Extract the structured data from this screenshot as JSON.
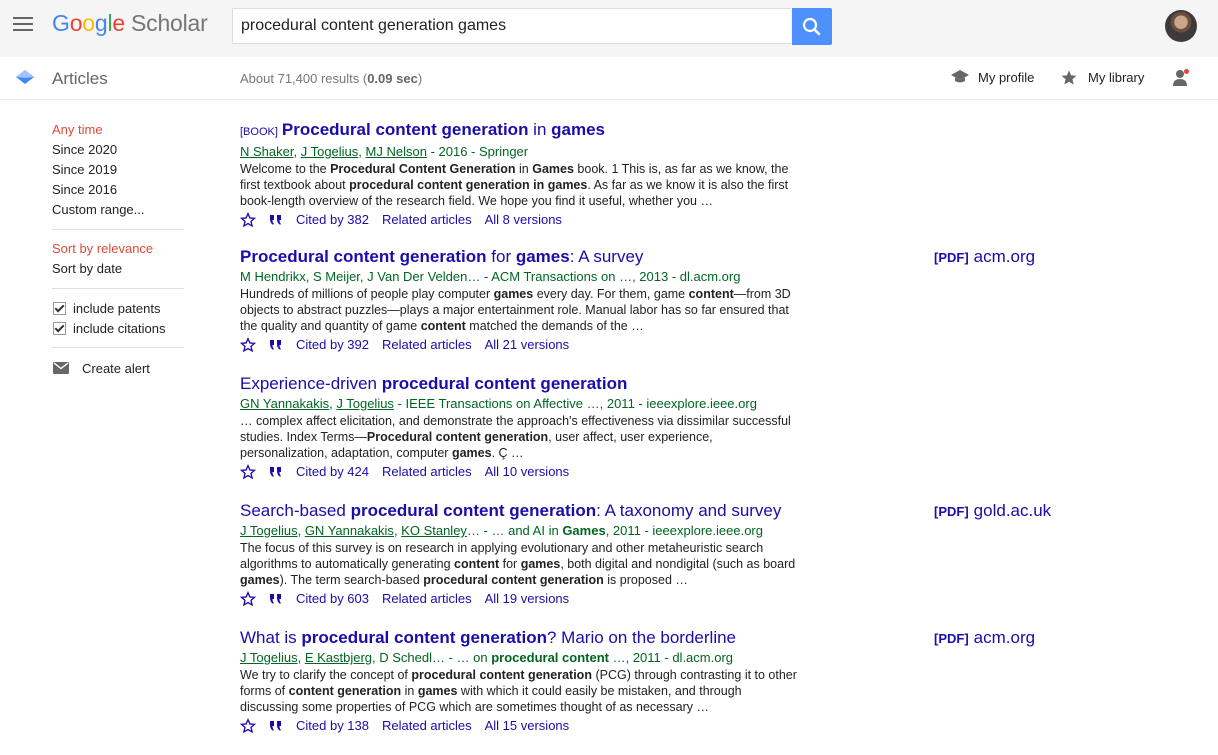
{
  "app": {
    "logo_google": "Google",
    "logo_scholar": "Scholar"
  },
  "search": {
    "query": "procedural content generation games"
  },
  "subheader": {
    "section_title": "Articles",
    "stats_prefix": "About 71,400 results (",
    "stats_time": "0.09 sec",
    "stats_suffix": ")",
    "my_profile": "My profile",
    "my_library": "My library"
  },
  "sidebar": {
    "time_filters": [
      "Any time",
      "Since 2020",
      "Since 2019",
      "Since 2016",
      "Custom range..."
    ],
    "sort_options": [
      "Sort by relevance",
      "Sort by date"
    ],
    "checkboxes": [
      "include patents",
      "include citations"
    ],
    "create_alert": "Create alert"
  },
  "results": [
    {
      "tag": "[BOOK]",
      "title_parts": [
        {
          "b": true,
          "t": "Procedural content generation"
        },
        {
          "b": false,
          "t": " in "
        },
        {
          "b": true,
          "t": "games"
        }
      ],
      "authors": [
        "N Shaker",
        "J Togelius",
        "MJ Nelson"
      ],
      "source": " - 2016 - Springer",
      "snippet": "Welcome to the <b>Procedural Content Generation</b> in <b>Games</b> book. 1 This is, as far as we know, the first textbook about <b>procedural content generation in games</b>. As far as we know it is also the first book-length overview of the research field. We hope you find it useful, whether you …",
      "cited_by": "Cited by 382",
      "related": "Related articles",
      "versions": "All 8 versions",
      "pdf_tag": "",
      "pdf_site": ""
    },
    {
      "tag": "",
      "title_parts": [
        {
          "b": true,
          "t": "Procedural content generation"
        },
        {
          "b": false,
          "t": " for "
        },
        {
          "b": true,
          "t": "games"
        },
        {
          "b": false,
          "t": ": A survey"
        }
      ],
      "authors_plain": "M Hendrikx, S Meijer, J Van Der Velden… - ACM Transactions on …, 2013 - dl.acm.org",
      "snippet": "Hundreds of millions of people play computer <b>games</b> every day. For them, game <b>content</b>—from 3D objects to abstract puzzles—plays a major entertainment role. Manual labor has so far ensured that the quality and quantity of game <b>content</b> matched the demands of the …",
      "cited_by": "Cited by 392",
      "related": "Related articles",
      "versions": "All 21 versions",
      "pdf_tag": "[PDF]",
      "pdf_site": "acm.org"
    },
    {
      "tag": "",
      "title_parts": [
        {
          "b": false,
          "t": "Experience-driven "
        },
        {
          "b": true,
          "t": "procedural content generation"
        }
      ],
      "authors": [
        "GN Yannakakis",
        "J Togelius"
      ],
      "source": " - IEEE Transactions on Affective …, 2011 - ieeexplore.ieee.org",
      "snippet": "… complex affect elicitation, and demonstrate the approach's effectiveness via dissimilar successful studies. Index Terms—<b>Procedural content generation</b>, user affect, user experience, personalization, adaptation, computer <b>games</b>. Ç …",
      "cited_by": "Cited by 424",
      "related": "Related articles",
      "versions": "All 10 versions",
      "pdf_tag": "",
      "pdf_site": ""
    },
    {
      "tag": "",
      "title_parts": [
        {
          "b": false,
          "t": "Search-based "
        },
        {
          "b": true,
          "t": "procedural content generation"
        },
        {
          "b": false,
          "t": ": A taxonomy and survey"
        }
      ],
      "authors": [
        "J Togelius",
        "GN Yannakakis",
        "KO Stanley"
      ],
      "source": "… - … and AI in <b>Games</b>, 2011 - ieeexplore.ieee.org",
      "snippet": "The focus of this survey is on research in applying evolutionary and other metaheuristic search algorithms to automatically generating <b>content</b> for <b>games</b>, both digital and nondigital (such as board <b>games</b>). The term search-based <b>procedural content generation</b> is proposed …",
      "cited_by": "Cited by 603",
      "related": "Related articles",
      "versions": "All 19 versions",
      "pdf_tag": "[PDF]",
      "pdf_site": "gold.ac.uk"
    },
    {
      "tag": "",
      "title_parts": [
        {
          "b": false,
          "t": "What is "
        },
        {
          "b": true,
          "t": "procedural content generation"
        },
        {
          "b": false,
          "t": "? Mario on the borderline"
        }
      ],
      "authors": [
        "J Togelius",
        "E Kastbjerg"
      ],
      "source": ", D Schedl… - … on <b>procedural content</b> …, 2011 - dl.acm.org",
      "snippet": "We try to clarify the concept of <b>procedural content generation</b> (PCG) through contrasting it to other forms of <b>content generation</b> in <b>games</b> with which it could easily be mistaken, and through discussing some properties of PCG which are sometimes thought of as necessary …",
      "cited_by": "Cited by 138",
      "related": "Related articles",
      "versions": "All 15 versions",
      "pdf_tag": "[PDF]",
      "pdf_site": "acm.org"
    }
  ],
  "colors": {
    "link": "#1a0dab",
    "green": "#006621",
    "selected": "#dd4b39",
    "search_btn": "#4d90fe"
  }
}
